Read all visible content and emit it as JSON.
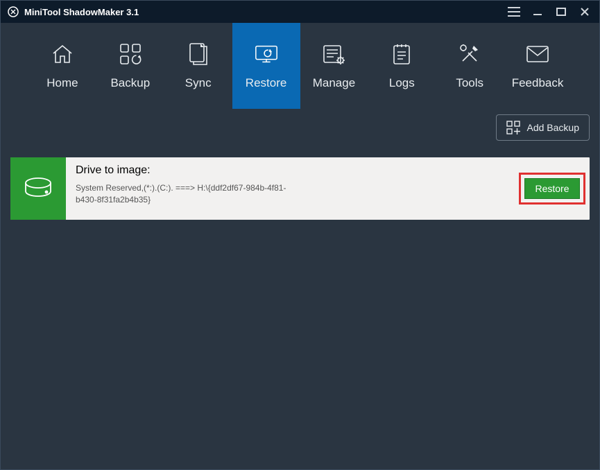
{
  "titlebar": {
    "app_title": "MiniTool ShadowMaker 3.1"
  },
  "nav": {
    "items": [
      {
        "label": "Home",
        "name": "home"
      },
      {
        "label": "Backup",
        "name": "backup"
      },
      {
        "label": "Sync",
        "name": "sync"
      },
      {
        "label": "Restore",
        "name": "restore",
        "active": true
      },
      {
        "label": "Manage",
        "name": "manage"
      },
      {
        "label": "Logs",
        "name": "logs"
      },
      {
        "label": "Tools",
        "name": "tools"
      },
      {
        "label": "Feedback",
        "name": "feedback"
      }
    ]
  },
  "toolbar": {
    "add_backup_label": "Add Backup"
  },
  "card": {
    "title": "Drive to image:",
    "detail": " System Reserved,(*:).(C:). ===> H:\\{ddf2df67-984b-4f81-b430-8f31fa2b4b35}",
    "restore_label": "Restore"
  },
  "colors": {
    "accent": "#0a69b3",
    "green": "#2b9a33",
    "highlight_border": "#e03030",
    "panel": "#2a3541",
    "titlebar": "#0d1b2a"
  }
}
